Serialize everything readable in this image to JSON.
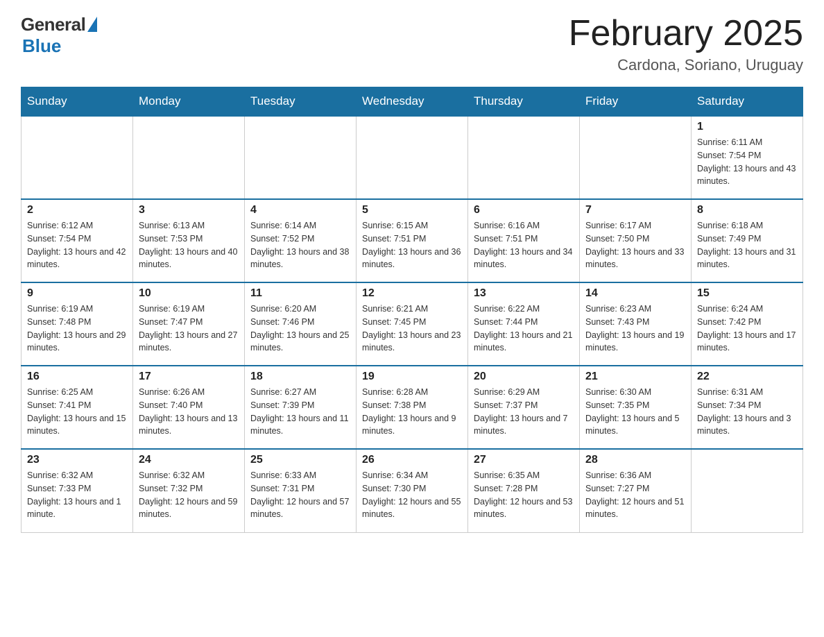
{
  "header": {
    "logo_general": "General",
    "logo_blue": "Blue",
    "month_title": "February 2025",
    "location": "Cardona, Soriano, Uruguay"
  },
  "days_of_week": [
    "Sunday",
    "Monday",
    "Tuesday",
    "Wednesday",
    "Thursday",
    "Friday",
    "Saturday"
  ],
  "weeks": [
    [
      {
        "day": "",
        "sunrise": "",
        "sunset": "",
        "daylight": ""
      },
      {
        "day": "",
        "sunrise": "",
        "sunset": "",
        "daylight": ""
      },
      {
        "day": "",
        "sunrise": "",
        "sunset": "",
        "daylight": ""
      },
      {
        "day": "",
        "sunrise": "",
        "sunset": "",
        "daylight": ""
      },
      {
        "day": "",
        "sunrise": "",
        "sunset": "",
        "daylight": ""
      },
      {
        "day": "",
        "sunrise": "",
        "sunset": "",
        "daylight": ""
      },
      {
        "day": "1",
        "sunrise": "Sunrise: 6:11 AM",
        "sunset": "Sunset: 7:54 PM",
        "daylight": "Daylight: 13 hours and 43 minutes."
      }
    ],
    [
      {
        "day": "2",
        "sunrise": "Sunrise: 6:12 AM",
        "sunset": "Sunset: 7:54 PM",
        "daylight": "Daylight: 13 hours and 42 minutes."
      },
      {
        "day": "3",
        "sunrise": "Sunrise: 6:13 AM",
        "sunset": "Sunset: 7:53 PM",
        "daylight": "Daylight: 13 hours and 40 minutes."
      },
      {
        "day": "4",
        "sunrise": "Sunrise: 6:14 AM",
        "sunset": "Sunset: 7:52 PM",
        "daylight": "Daylight: 13 hours and 38 minutes."
      },
      {
        "day": "5",
        "sunrise": "Sunrise: 6:15 AM",
        "sunset": "Sunset: 7:51 PM",
        "daylight": "Daylight: 13 hours and 36 minutes."
      },
      {
        "day": "6",
        "sunrise": "Sunrise: 6:16 AM",
        "sunset": "Sunset: 7:51 PM",
        "daylight": "Daylight: 13 hours and 34 minutes."
      },
      {
        "day": "7",
        "sunrise": "Sunrise: 6:17 AM",
        "sunset": "Sunset: 7:50 PM",
        "daylight": "Daylight: 13 hours and 33 minutes."
      },
      {
        "day": "8",
        "sunrise": "Sunrise: 6:18 AM",
        "sunset": "Sunset: 7:49 PM",
        "daylight": "Daylight: 13 hours and 31 minutes."
      }
    ],
    [
      {
        "day": "9",
        "sunrise": "Sunrise: 6:19 AM",
        "sunset": "Sunset: 7:48 PM",
        "daylight": "Daylight: 13 hours and 29 minutes."
      },
      {
        "day": "10",
        "sunrise": "Sunrise: 6:19 AM",
        "sunset": "Sunset: 7:47 PM",
        "daylight": "Daylight: 13 hours and 27 minutes."
      },
      {
        "day": "11",
        "sunrise": "Sunrise: 6:20 AM",
        "sunset": "Sunset: 7:46 PM",
        "daylight": "Daylight: 13 hours and 25 minutes."
      },
      {
        "day": "12",
        "sunrise": "Sunrise: 6:21 AM",
        "sunset": "Sunset: 7:45 PM",
        "daylight": "Daylight: 13 hours and 23 minutes."
      },
      {
        "day": "13",
        "sunrise": "Sunrise: 6:22 AM",
        "sunset": "Sunset: 7:44 PM",
        "daylight": "Daylight: 13 hours and 21 minutes."
      },
      {
        "day": "14",
        "sunrise": "Sunrise: 6:23 AM",
        "sunset": "Sunset: 7:43 PM",
        "daylight": "Daylight: 13 hours and 19 minutes."
      },
      {
        "day": "15",
        "sunrise": "Sunrise: 6:24 AM",
        "sunset": "Sunset: 7:42 PM",
        "daylight": "Daylight: 13 hours and 17 minutes."
      }
    ],
    [
      {
        "day": "16",
        "sunrise": "Sunrise: 6:25 AM",
        "sunset": "Sunset: 7:41 PM",
        "daylight": "Daylight: 13 hours and 15 minutes."
      },
      {
        "day": "17",
        "sunrise": "Sunrise: 6:26 AM",
        "sunset": "Sunset: 7:40 PM",
        "daylight": "Daylight: 13 hours and 13 minutes."
      },
      {
        "day": "18",
        "sunrise": "Sunrise: 6:27 AM",
        "sunset": "Sunset: 7:39 PM",
        "daylight": "Daylight: 13 hours and 11 minutes."
      },
      {
        "day": "19",
        "sunrise": "Sunrise: 6:28 AM",
        "sunset": "Sunset: 7:38 PM",
        "daylight": "Daylight: 13 hours and 9 minutes."
      },
      {
        "day": "20",
        "sunrise": "Sunrise: 6:29 AM",
        "sunset": "Sunset: 7:37 PM",
        "daylight": "Daylight: 13 hours and 7 minutes."
      },
      {
        "day": "21",
        "sunrise": "Sunrise: 6:30 AM",
        "sunset": "Sunset: 7:35 PM",
        "daylight": "Daylight: 13 hours and 5 minutes."
      },
      {
        "day": "22",
        "sunrise": "Sunrise: 6:31 AM",
        "sunset": "Sunset: 7:34 PM",
        "daylight": "Daylight: 13 hours and 3 minutes."
      }
    ],
    [
      {
        "day": "23",
        "sunrise": "Sunrise: 6:32 AM",
        "sunset": "Sunset: 7:33 PM",
        "daylight": "Daylight: 13 hours and 1 minute."
      },
      {
        "day": "24",
        "sunrise": "Sunrise: 6:32 AM",
        "sunset": "Sunset: 7:32 PM",
        "daylight": "Daylight: 12 hours and 59 minutes."
      },
      {
        "day": "25",
        "sunrise": "Sunrise: 6:33 AM",
        "sunset": "Sunset: 7:31 PM",
        "daylight": "Daylight: 12 hours and 57 minutes."
      },
      {
        "day": "26",
        "sunrise": "Sunrise: 6:34 AM",
        "sunset": "Sunset: 7:30 PM",
        "daylight": "Daylight: 12 hours and 55 minutes."
      },
      {
        "day": "27",
        "sunrise": "Sunrise: 6:35 AM",
        "sunset": "Sunset: 7:28 PM",
        "daylight": "Daylight: 12 hours and 53 minutes."
      },
      {
        "day": "28",
        "sunrise": "Sunrise: 6:36 AM",
        "sunset": "Sunset: 7:27 PM",
        "daylight": "Daylight: 12 hours and 51 minutes."
      },
      {
        "day": "",
        "sunrise": "",
        "sunset": "",
        "daylight": ""
      }
    ]
  ]
}
